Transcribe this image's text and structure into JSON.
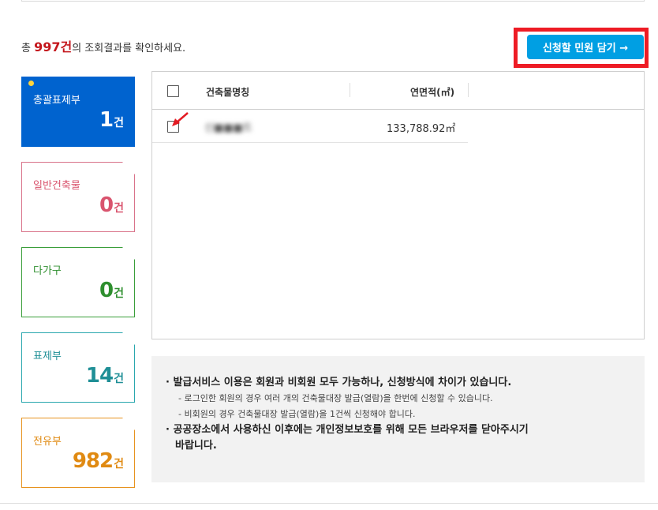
{
  "summary": {
    "prefix": "총 ",
    "count": "997건",
    "suffix": "의 조회결과를 확인하세요."
  },
  "cart_button": {
    "label": "신청할 민원 담기 →"
  },
  "cards": {
    "total": {
      "label": "총괄표제부",
      "num": "1",
      "unit": "건"
    },
    "general": {
      "label": "일반건축물",
      "num": "0",
      "unit": "건"
    },
    "multi": {
      "label": "다가구",
      "num": "0",
      "unit": "건"
    },
    "title": {
      "label": "표제부",
      "num": "14",
      "unit": "건"
    },
    "exclusive": {
      "label": "전유부",
      "num": "982",
      "unit": "건"
    }
  },
  "table": {
    "headers": {
      "name": "건축물명칭",
      "area": "연면적(㎡)"
    },
    "rows": [
      {
        "name": "신■■■트",
        "area": "133,788.92㎡"
      }
    ]
  },
  "notice": {
    "line1": "· 발급서비스 이용은 회원과 비회원 모두 가능하나, 신청방식에 차이가 있습니다.",
    "sub1": "- 로그인한 회원의 경우 여러 개의 건축물대장 발급(열람)을 한번에 신청할 수 있습니다.",
    "sub2": "- 비회원의 경우 건축물대장 발급(열람)을 1건씩 신청해야 합니다.",
    "line2a": "· 공공장소에서 사용하신 이후에는 개인정보보호를 위해 모든 브라우저를 닫아주시기",
    "line2b": "바랍니다."
  },
  "colors": {
    "accent_blue": "#009fe3",
    "total_card": "#0063cf",
    "count_red": "#c4161c",
    "highlight_frame": "#ee1c25"
  }
}
